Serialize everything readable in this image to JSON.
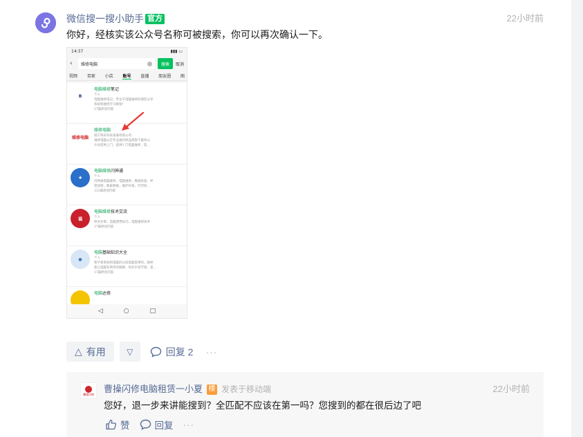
{
  "comment": {
    "author": "微信搜一搜小助手",
    "badge": "官方",
    "time": "22小时前",
    "text": "你好，经核实该公众号名称可被搜索，你可以再次确认一下。",
    "actions": {
      "useful_label": "有用",
      "reply_label": "回复 2",
      "more_label": "···"
    }
  },
  "screenshot": {
    "status_time": "14:37",
    "search_query": "维修电脑",
    "search_button": "搜索",
    "cancel": "取消",
    "tabs": [
      "视频",
      "百家",
      "小店",
      "账号",
      "直播",
      "朋友圈",
      "图"
    ],
    "active_tab": "账号",
    "results": [
      {
        "logo": "B",
        "logo_color": "#1f3a7a",
        "logo_bg": "#ffffff",
        "name_hl": "电脑维修",
        "name_rest": "笔记",
        "kind": "个人",
        "desc1": "电脑维修笔记，专注于电脑维修的朋友分享",
        "desc2": "系统和维修学习教程！",
        "meta": "27篇原创内容"
      },
      {
        "logo": "维修电脑",
        "logo_color": "#d0262b",
        "logo_bg": "#ffffff",
        "name_hl": "维修电脑",
        "name_rest": "",
        "kind": "咸宁快乐科技发展有限公司",
        "desc1": "维修电脑以在专业通闪修品牌旗下服务公",
        "desc2": "众号提供上门，提供1.门电脑维修、电…",
        "meta": ""
      },
      {
        "logo": "✚",
        "logo_color": "#ffffff",
        "logo_bg": "#2a6fc9",
        "name_hl": "电脑维修",
        "name_rest": "闪神通",
        "kind": "个人",
        "desc1": "闪神通电脑维修，电脑维修，数据恢复、杯",
        "desc2": "密加密，数据救援，维护升级，打印机…",
        "meta": "131篇原创内容"
      },
      {
        "logo": "福",
        "logo_color": "#ffffff",
        "logo_bg": "#c8202c",
        "name_hl": "电脑维修",
        "name_rest": "技术交流",
        "kind": "个人",
        "desc1": "原创文章，电脑使用技巧，电脑维修技术",
        "desc2": "",
        "meta": "27篇原创内容"
      },
      {
        "logo": "●",
        "logo_color": "#3a79c2",
        "logo_bg": "#d8e6f5",
        "name_hl": "电脑",
        "name_rest": "基础知识大全",
        "kind": "个人",
        "desc1": "和学者系统和电脑的认知电脑常用的，相并",
        "desc2": "家让电脑有简单的图解，你对于初学者，是…",
        "meta": "17篇原创内容"
      },
      {
        "logo": "",
        "logo_color": "#fff",
        "logo_bg": "#f5c400",
        "name_hl": "电脑",
        "name_rest": "达修",
        "kind": "",
        "desc1": "",
        "desc2": "",
        "meta": ""
      }
    ],
    "nav": [
      "◁",
      "○",
      "□"
    ]
  },
  "reply": {
    "author": "曹操闪修电脑租赁一小夏",
    "badge": "楼",
    "via": "发表于移动端",
    "time": "22小时前",
    "text": "您好，退一步来讲能搜到？全匹配不应该在第一吗？您搜到的都在很后边了吧",
    "avatar_label": "曹操闪修",
    "actions": {
      "like_label": "赞",
      "reply_label": "回复",
      "more_label": "···"
    }
  }
}
